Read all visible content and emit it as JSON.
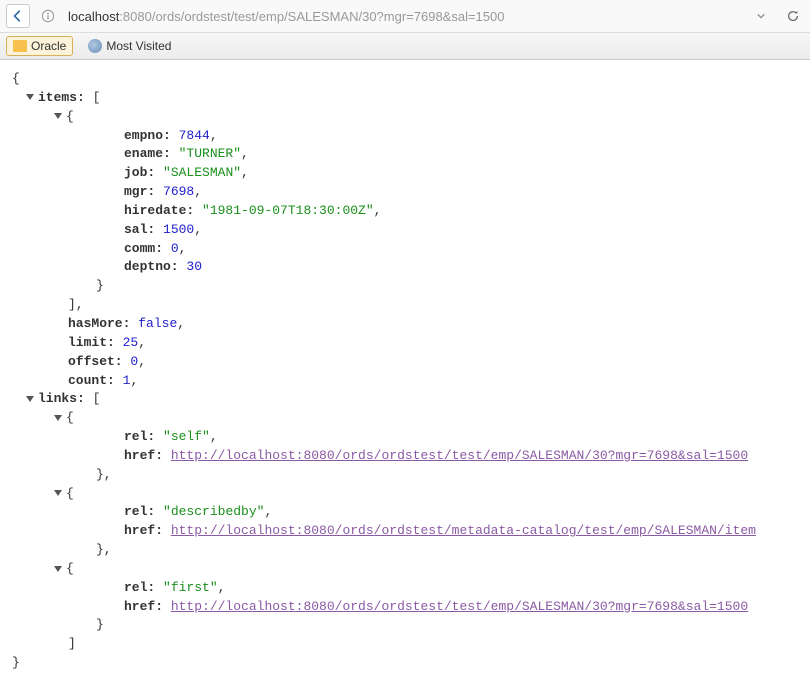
{
  "toolbar": {
    "url_prefix": "localhost",
    "url_rest": ":8080/ords/ordstest/test/emp/SALESMAN/30?mgr=7698&sal=1500"
  },
  "bookmarks": {
    "oracle": "Oracle",
    "most_visited": "Most Visited"
  },
  "json": {
    "items_key": "items:",
    "empno_key": "empno:",
    "empno_val": "7844",
    "ename_key": "ename:",
    "ename_val": "\"TURNER\"",
    "job_key": "job:",
    "job_val": "\"SALESMAN\"",
    "mgr_key": "mgr:",
    "mgr_val": "7698",
    "hiredate_key": "hiredate:",
    "hiredate_val": "\"1981-09-07T18:30:00Z\"",
    "sal_key": "sal:",
    "sal_val": "1500",
    "comm_key": "comm:",
    "comm_val": "0",
    "deptno_key": "deptno:",
    "deptno_val": "30",
    "hasmore_key": "hasMore:",
    "hasmore_val": "false",
    "limit_key": "limit:",
    "limit_val": "25",
    "offset_key": "offset:",
    "offset_val": "0",
    "count_key": "count:",
    "count_val": "1",
    "links_key": "links:",
    "rel_key": "rel:",
    "href_key": "href:",
    "rel_self": "\"self\"",
    "href_self": "http://localhost:8080/ords/ordstest/test/emp/SALESMAN/30?mgr=7698&sal=1500",
    "rel_describedby": "\"describedby\"",
    "href_describedby": "http://localhost:8080/ords/ordstest/metadata-catalog/test/emp/SALESMAN/item",
    "rel_first": "\"first\"",
    "href_first": "http://localhost:8080/ords/ordstest/test/emp/SALESMAN/30?mgr=7698&sal=1500"
  }
}
